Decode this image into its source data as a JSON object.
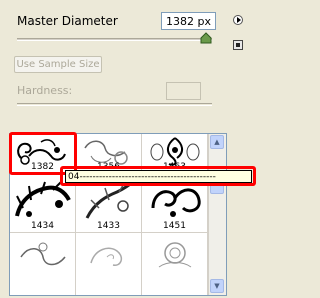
{
  "master_diameter": {
    "label": "Master Diameter",
    "value": "1382 px",
    "slider_level": 0.95
  },
  "use_sample_size": {
    "label": "Use Sample Size"
  },
  "hardness": {
    "label": "Hardness:",
    "value": ""
  },
  "brushes": [
    {
      "label": "1382"
    },
    {
      "label": "1356"
    },
    {
      "label": "1463"
    },
    {
      "label": "1434"
    },
    {
      "label": "1433"
    },
    {
      "label": "1451"
    },
    {
      "label": ""
    },
    {
      "label": ""
    },
    {
      "label": ""
    }
  ],
  "tooltip": {
    "text": "04------------------------------------------"
  },
  "accent_color": "#ff0000"
}
